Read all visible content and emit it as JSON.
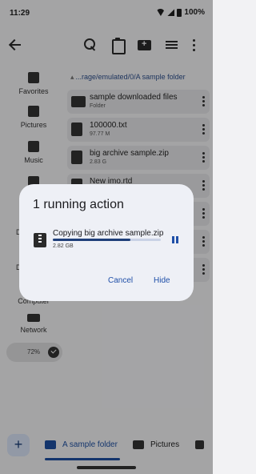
{
  "status_bar": {
    "time": "11:29",
    "battery": "100%"
  },
  "toolbar": {
    "icons": [
      "back-arrow-icon",
      "search-icon",
      "clipboard-icon",
      "new-folder-icon",
      "view-list-icon",
      "more-vert-icon"
    ]
  },
  "sidebar": {
    "items": [
      {
        "label": "Favorites",
        "icon": "star-folder-icon"
      },
      {
        "label": "Pictures",
        "icon": "image-icon"
      },
      {
        "label": "Music",
        "icon": "music-icon"
      },
      {
        "label": "",
        "icon": "video-icon"
      },
      {
        "label": "D",
        "icon": ""
      },
      {
        "label": "D",
        "icon": ""
      },
      {
        "label": "Computer",
        "icon": ""
      },
      {
        "label": "Network",
        "icon": "laptop-icon"
      }
    ],
    "storage_percent": "72%"
  },
  "breadcrumb": {
    "path": "...rage/emulated/0/A sample folder"
  },
  "files": [
    {
      "name": "sample downloaded files",
      "meta": "Folder",
      "icon": "folder-icon"
    },
    {
      "name": "100000.txt",
      "meta": "97.77 M",
      "icon": "text-file-icon"
    },
    {
      "name": "big archive sample.zip",
      "meta": "2.83 G",
      "icon": "zip-file-icon"
    },
    {
      "name": "New imo.rtd",
      "meta": "",
      "icon": "file-icon"
    }
  ],
  "dialog": {
    "title": "1 running action",
    "action_name": "Copying big archive sample.zip",
    "action_size": "2.82 GB",
    "progress": 0.72,
    "cancel_label": "Cancel",
    "hide_label": "Hide"
  },
  "bottom_tabs": {
    "add_label": "+",
    "tabs": [
      {
        "label": "A sample folder",
        "active": true
      },
      {
        "label": "Pictures",
        "active": false
      },
      {
        "label": "",
        "active": false
      }
    ]
  },
  "colors": {
    "accent": "#1e4fa0",
    "dialog_bg": "#eef0f6",
    "scrim": "rgba(0,0,0,0.32)"
  }
}
